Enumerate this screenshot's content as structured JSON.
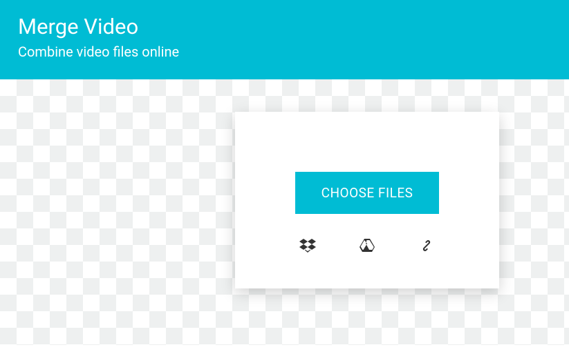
{
  "header": {
    "title": "Merge Video",
    "subtitle": "Combine video files online"
  },
  "upload": {
    "button_label": "CHOOSE FILES",
    "sources": {
      "dropbox": "Dropbox",
      "gdrive": "Google Drive",
      "url": "URL"
    }
  },
  "colors": {
    "accent": "#00bcd4"
  }
}
